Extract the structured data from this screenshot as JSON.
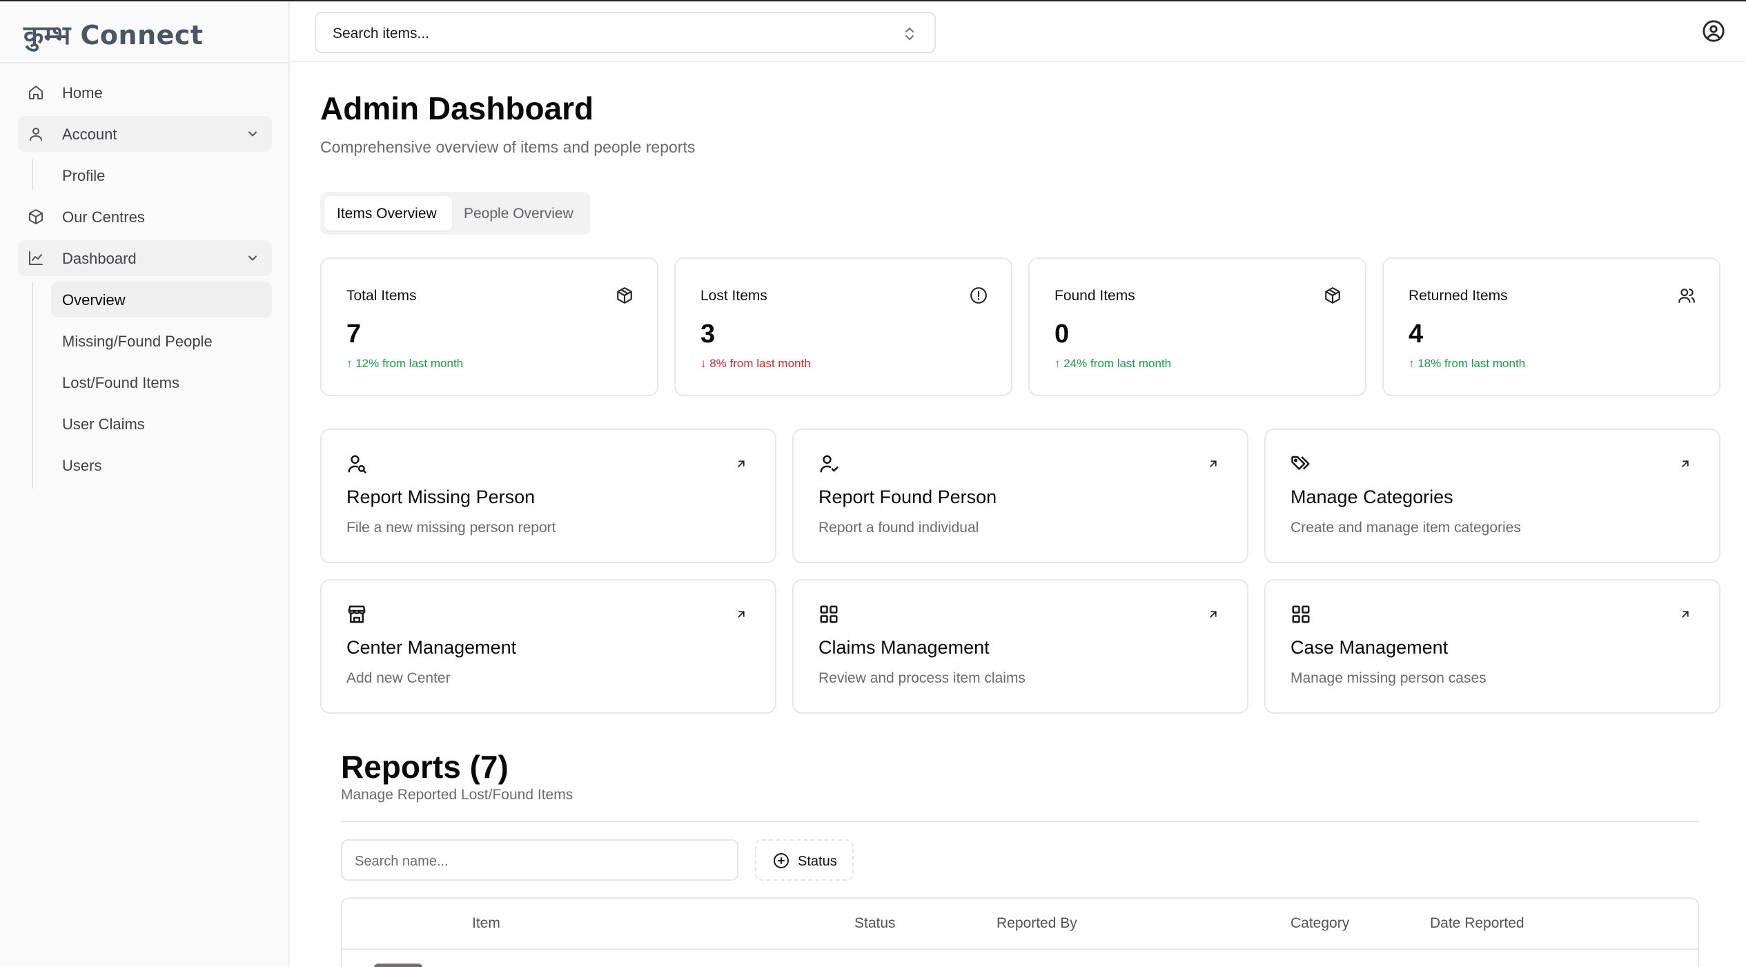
{
  "app": {
    "logo": "कुम्भ Connect"
  },
  "search": {
    "value": "Search items..."
  },
  "sidebar": {
    "items": [
      {
        "label": "Home",
        "icon": "home-icon"
      },
      {
        "label": "Account",
        "icon": "user-icon",
        "expanded": true
      },
      {
        "label": "Profile"
      },
      {
        "label": "Our Centres",
        "icon": "box-icon"
      },
      {
        "label": "Dashboard",
        "icon": "chart-icon",
        "expanded": true
      },
      {
        "label": "Overview",
        "active": true
      },
      {
        "label": "Missing/Found People"
      },
      {
        "label": "Lost/Found Items"
      },
      {
        "label": "User Claims"
      },
      {
        "label": "Users"
      }
    ]
  },
  "header": {
    "title": "Admin Dashboard",
    "subtitle": "Comprehensive overview of items and people reports"
  },
  "tabs": [
    {
      "label": "Items Overview",
      "active": true
    },
    {
      "label": "People Overview",
      "active": false
    }
  ],
  "stats": [
    {
      "title": "Total Items",
      "value": "7",
      "trend": "↑ 12% from last month",
      "direction": "up",
      "icon": "package-icon"
    },
    {
      "title": "Lost Items",
      "value": "3",
      "trend": "↓ 8% from last month",
      "direction": "down",
      "icon": "alert-circle-icon"
    },
    {
      "title": "Found Items",
      "value": "0",
      "trend": "↑ 24% from last month",
      "direction": "up",
      "icon": "package-icon"
    },
    {
      "title": "Returned Items",
      "value": "4",
      "trend": "↑ 18% from last month",
      "direction": "up",
      "icon": "users-icon"
    }
  ],
  "actions": [
    {
      "title": "Report Missing Person",
      "desc": "File a new missing person report",
      "icon": "user-search-icon"
    },
    {
      "title": "Report Found Person",
      "desc": "Report a found individual",
      "icon": "user-check-icon"
    },
    {
      "title": "Manage Categories",
      "desc": "Create and manage item categories",
      "icon": "tags-icon"
    },
    {
      "title": "Center Management",
      "desc": "Add new Center",
      "icon": "store-icon"
    },
    {
      "title": "Claims Management",
      "desc": "Review and process item claims",
      "icon": "grid-icon"
    },
    {
      "title": "Case Management",
      "desc": "Manage missing person cases",
      "icon": "grid-icon"
    }
  ],
  "reports": {
    "title": "Reports (7)",
    "subtitle": "Manage Reported Lost/Found Items",
    "search_placeholder": "Search name...",
    "status_label": "Status",
    "columns": [
      "Item",
      "Status",
      "Reported By",
      "Category",
      "Date Reported"
    ]
  },
  "colors": {
    "trend_up": "#16a34a",
    "trend_down": "#dc2626",
    "logo": "#4b5563"
  }
}
